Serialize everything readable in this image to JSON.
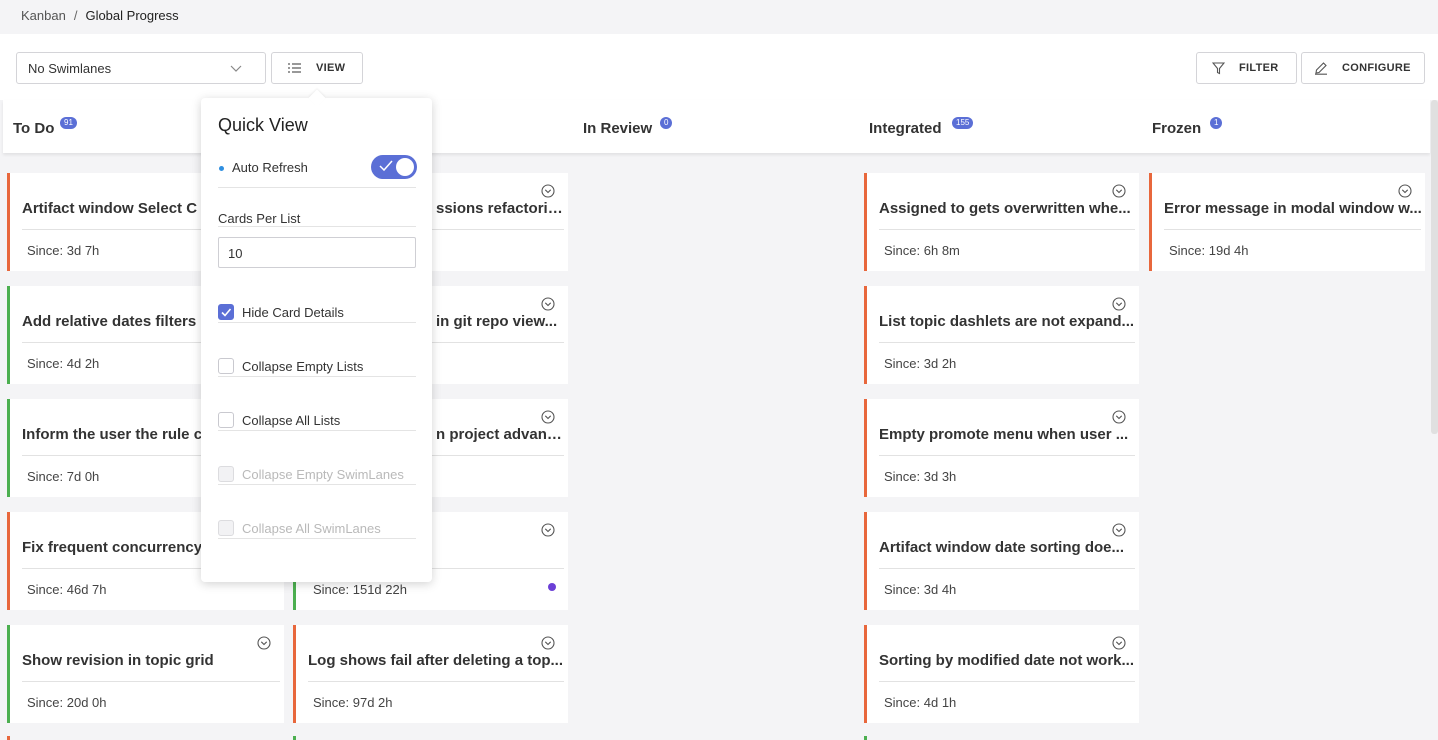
{
  "breadcrumb": {
    "root": "Kanban",
    "separator": "/",
    "current": "Global Progress"
  },
  "toolbar": {
    "swimlane_select": "No Swimlanes",
    "view_label": "VIEW",
    "filter_label": "FILTER",
    "configure_label": "CONFIGURE"
  },
  "columns": [
    {
      "title": "To Do",
      "count": "91"
    },
    {
      "title": "In Review",
      "count": "0"
    },
    {
      "title": "Integrated",
      "count": "155"
    },
    {
      "title": "Frozen",
      "count": "1"
    }
  ],
  "colors": {
    "accent": "#5b6fd6",
    "border_orange": "#e8673c",
    "border_green": "#4caf50",
    "dot_purple": "#6b3fd6"
  },
  "cards": {
    "todo": [
      {
        "title": "Artifact window Select C",
        "since": "Since: 3d 7h"
      },
      {
        "title": "Add relative dates filters",
        "since": "Since: 4d 2h"
      },
      {
        "title": "Inform the user the rule c",
        "since": "Since: 7d 0h"
      },
      {
        "title": "Fix frequent concurrency",
        "since": "Since: 46d 7h"
      },
      {
        "title": "Show revision in topic grid",
        "since": "Since: 20d 0h"
      }
    ],
    "progress": [
      {
        "title": "ssions refactoring",
        "since": ""
      },
      {
        "title": "in git repo view...",
        "since": ""
      },
      {
        "title": "n project advanc...",
        "since": ""
      },
      {
        "title": "",
        "since": "Since: 151d 22h"
      },
      {
        "title": "Log shows fail after deleting a top...",
        "since": "Since: 97d 2h"
      }
    ],
    "integrated": [
      {
        "title": "Assigned to gets overwritten whe...",
        "since": "Since: 6h 8m"
      },
      {
        "title": "List topic dashlets are not expand...",
        "since": "Since: 3d 2h"
      },
      {
        "title": "Empty promote menu when user ...",
        "since": "Since: 3d 3h"
      },
      {
        "title": "Artifact window date sorting doe...",
        "since": "Since: 3d 4h"
      },
      {
        "title": "Sorting by modified date not work...",
        "since": "Since: 4d 1h"
      }
    ],
    "frozen": [
      {
        "title": "Error message in modal window w...",
        "since": "Since: 19d 4h"
      }
    ]
  },
  "quick_view": {
    "title": "Quick View",
    "auto_refresh": "Auto Refresh",
    "auto_refresh_on": true,
    "cards_per_list_label": "Cards Per List",
    "cards_per_list_value": "10",
    "hide_card_details": "Hide Card Details",
    "collapse_empty_lists": "Collapse Empty Lists",
    "collapse_all_lists": "Collapse All Lists",
    "collapse_empty_swimlanes": "Collapse Empty SwimLanes",
    "collapse_all_swimlanes": "Collapse All SwimLanes"
  }
}
